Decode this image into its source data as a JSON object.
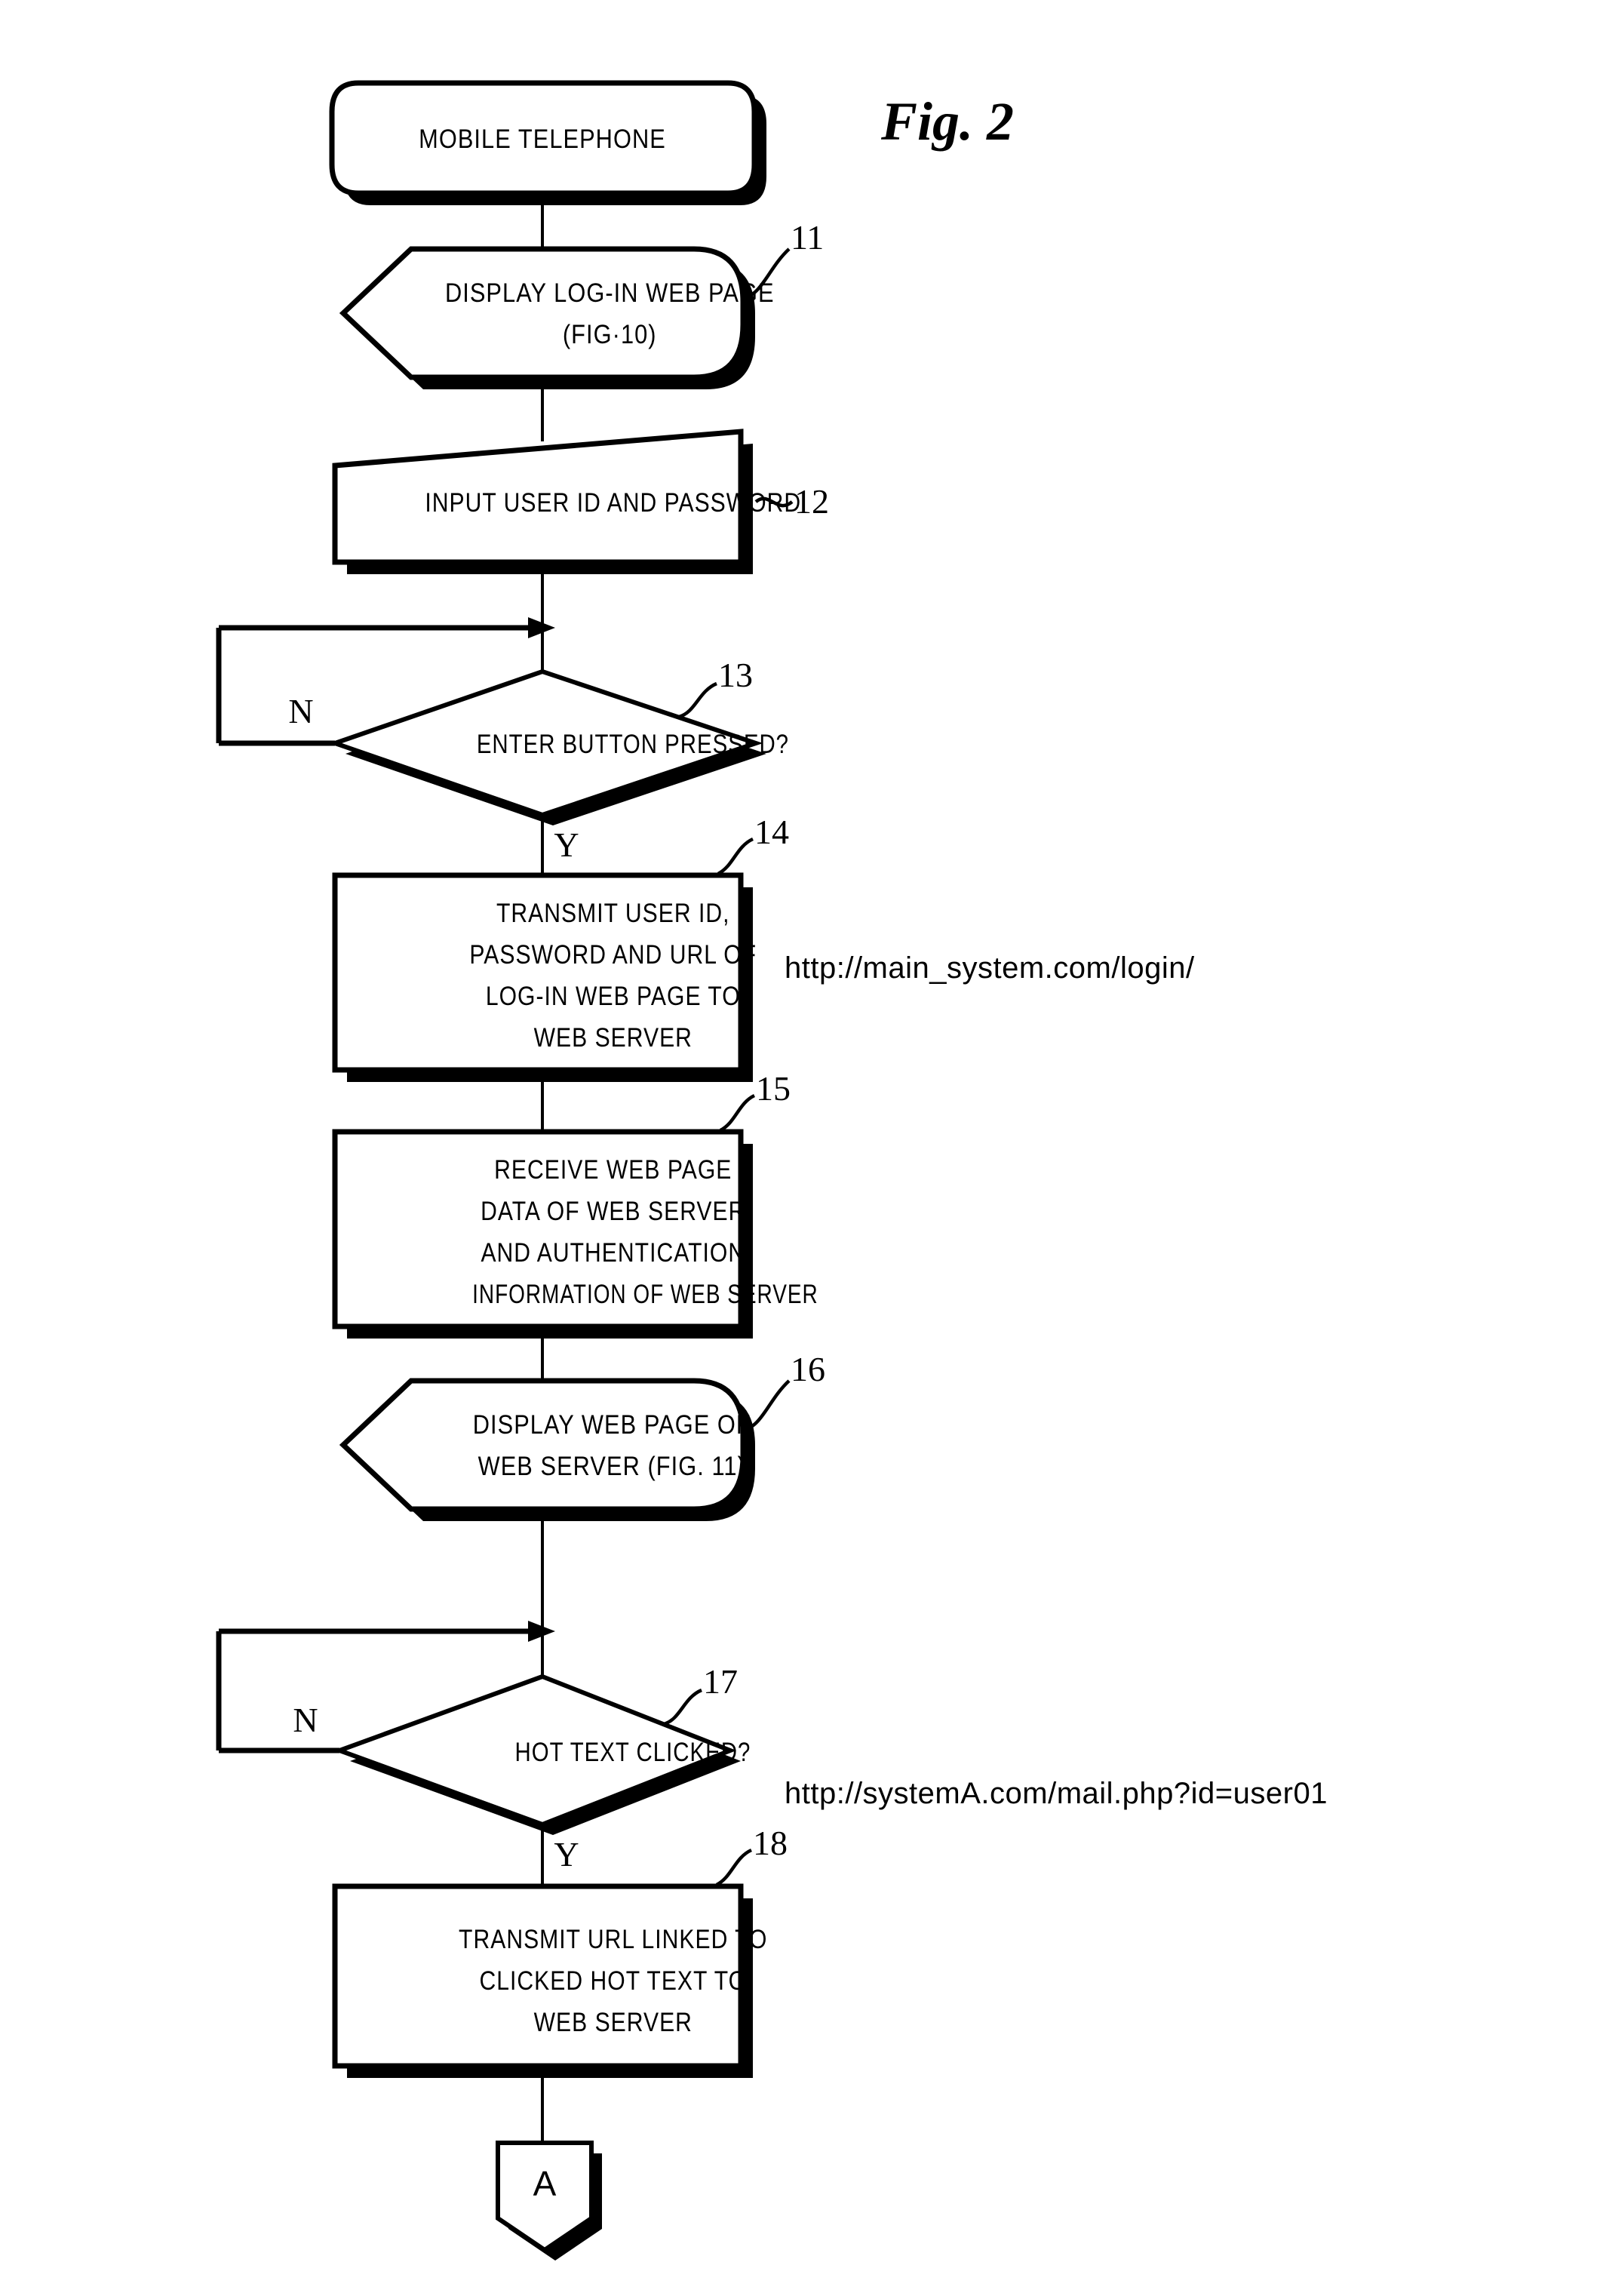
{
  "figure": {
    "label": "Fig. 2",
    "title": "MOBILE TELEPHONE"
  },
  "urls": {
    "login": "http://main_system.com/login/",
    "mail": "http://systemA.com/mail.php?id=user01"
  },
  "branch_labels": {
    "no": "N",
    "yes": "Y"
  },
  "steps": [
    {
      "ref": "11",
      "shape": "display",
      "lines": [
        "DISPLAY LOG-IN WEB PAGE",
        "(FIG·10)"
      ]
    },
    {
      "ref": "12",
      "shape": "manual-input",
      "lines": [
        "INPUT USER ID AND PASSWORD"
      ]
    },
    {
      "ref": "13",
      "shape": "decision",
      "lines": [
        "ENTER BUTTON PRESSED?"
      ]
    },
    {
      "ref": "14",
      "shape": "process",
      "lines": [
        "TRANSMIT USER ID,",
        "PASSWORD AND URL OF",
        "LOG-IN WEB PAGE TO",
        "WEB SERVER"
      ]
    },
    {
      "ref": "15",
      "shape": "process",
      "lines": [
        "RECEIVE WEB PAGE",
        "DATA OF WEB SERVER",
        "AND AUTHENTICATION",
        "INFORMATION OF WEB SERVER"
      ]
    },
    {
      "ref": "16",
      "shape": "display",
      "lines": [
        "DISPLAY WEB PAGE OF",
        "WEB SERVER (FIG. 11)"
      ]
    },
    {
      "ref": "17",
      "shape": "decision",
      "lines": [
        "HOT TEXT CLICKED?"
      ]
    },
    {
      "ref": "18",
      "shape": "process",
      "lines": [
        "TRANSMIT URL LINKED TO",
        "CLICKED HOT TEXT TO",
        "WEB SERVER"
      ]
    }
  ],
  "connector": {
    "label": "A"
  },
  "colors": {
    "ink": "#000000",
    "paper": "#ffffff"
  }
}
